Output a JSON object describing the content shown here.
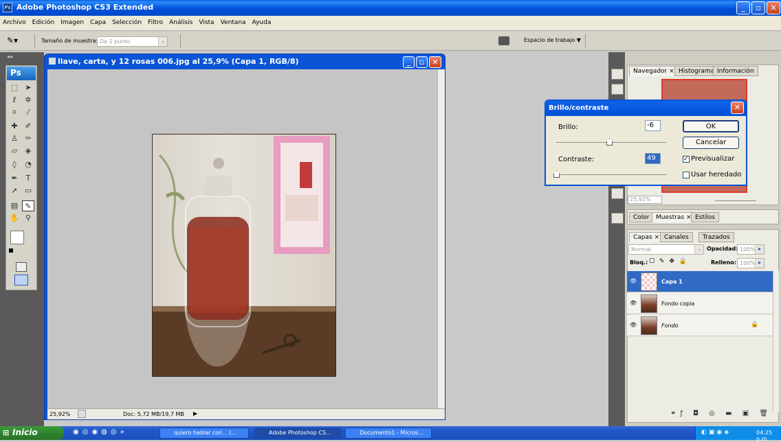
{
  "app": {
    "title": "Adobe Photoshop CS3 Extended",
    "icon_text": "Ps"
  },
  "menu": [
    "Archivo",
    "Edición",
    "Imagen",
    "Capa",
    "Selección",
    "Filtro",
    "Análisis",
    "Vista",
    "Ventana",
    "Ayuda"
  ],
  "options_bar": {
    "sample_label": "Tamaño de muestra:",
    "sample_value": "De 1 punto",
    "workspace_label": "Espacio de trabajo"
  },
  "toolbox": {
    "logo": "Ps"
  },
  "document": {
    "title": "llave, carta, y 12 rosas 006.jpg al 25,9% (Capa 1, RGB/8)",
    "zoom": "25,92%",
    "doc_info": "Doc: 5,72 MB/19,7 MB"
  },
  "navigator_panel": {
    "tabs": [
      "Navegador ×",
      "Histograma",
      "Información"
    ],
    "zoom": "25,92%"
  },
  "color_panel": {
    "tabs": [
      "Color",
      "Muestras ×",
      "Estilos"
    ]
  },
  "layers_panel": {
    "tabs": [
      "Capas ×",
      "Canales",
      "Trazados"
    ],
    "blend_mode": "Normal",
    "opacity_label": "Opacidad:",
    "opacity_value": "100%",
    "lock_label": "Bloq.:",
    "fill_label": "Relleno:",
    "fill_value": "100%",
    "layers": [
      {
        "name": "Capa 1",
        "selected": true
      },
      {
        "name": "Fondo copia",
        "selected": false
      },
      {
        "name": "Fondo",
        "selected": false,
        "locked": true
      }
    ]
  },
  "dialog": {
    "title": "Brillo/contraste",
    "brightness_label": "Brillo:",
    "brightness_value": "-6",
    "contrast_label": "Contraste:",
    "contrast_value": "49",
    "ok": "OK",
    "cancel": "Cancelar",
    "preview_label": "Previsualizar",
    "preview_checked": true,
    "legacy_label": "Usar heredado",
    "legacy_checked": false
  },
  "taskbar": {
    "start": "Inicio",
    "items": [
      "quiero hablar con... (...",
      "Adobe Photoshop CS...",
      "Documento1 - Micros..."
    ],
    "clock": "04:25 p.m."
  }
}
